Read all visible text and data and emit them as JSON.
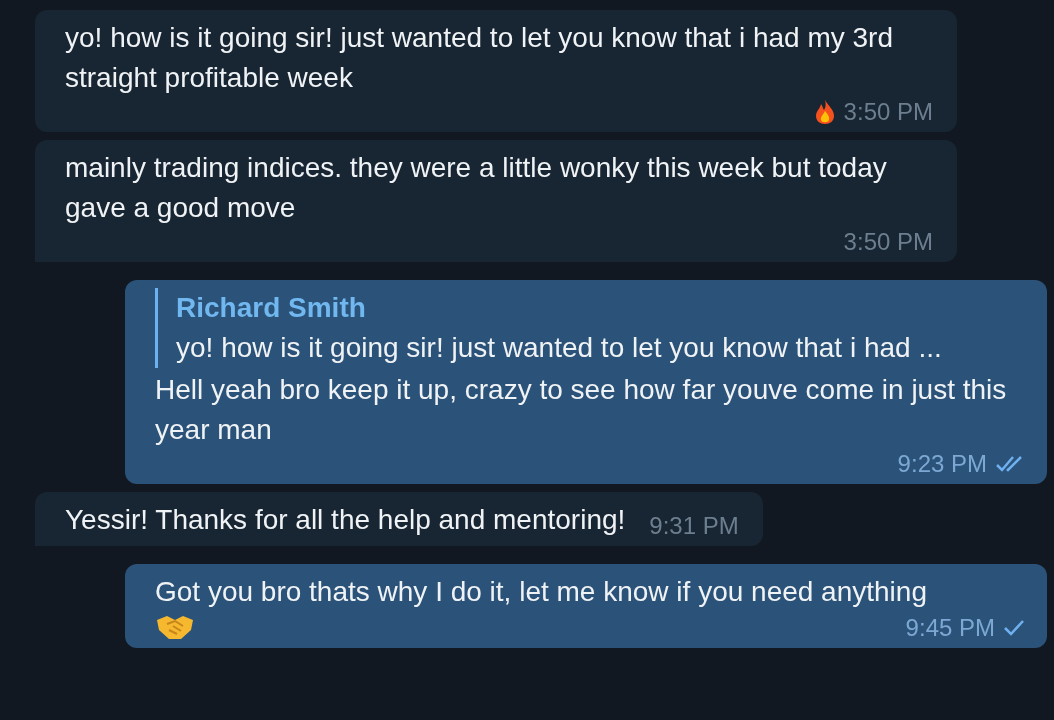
{
  "messages": [
    {
      "kind": "incoming",
      "text": "yo! how is it going sir! just wanted to let you know that i had my 3rd straight profitable week",
      "time": "3:50 PM",
      "reaction": true,
      "tail": false
    },
    {
      "kind": "incoming",
      "text": "mainly trading indices. they were a little wonky this week but today gave a good move",
      "time": "3:50 PM",
      "reaction": false,
      "tail": true
    },
    {
      "kind": "outgoing",
      "reply": {
        "name": "Richard Smith",
        "text": "yo! how is it going sir! just wanted to let you know that i had ..."
      },
      "text": "Hell yeah bro keep it up, crazy to see how far youve come in just this year man",
      "time": "9:23 PM",
      "read": true
    },
    {
      "kind": "incoming",
      "text": "Yessir! Thanks for all the help and mentoring!",
      "time": "9:31 PM",
      "reaction": false,
      "tail": true
    },
    {
      "kind": "outgoing",
      "text": "Got you bro thats why I do it, let me know if you need anything",
      "time": "9:45 PM",
      "read": false,
      "trailing_emoji": true
    }
  ]
}
